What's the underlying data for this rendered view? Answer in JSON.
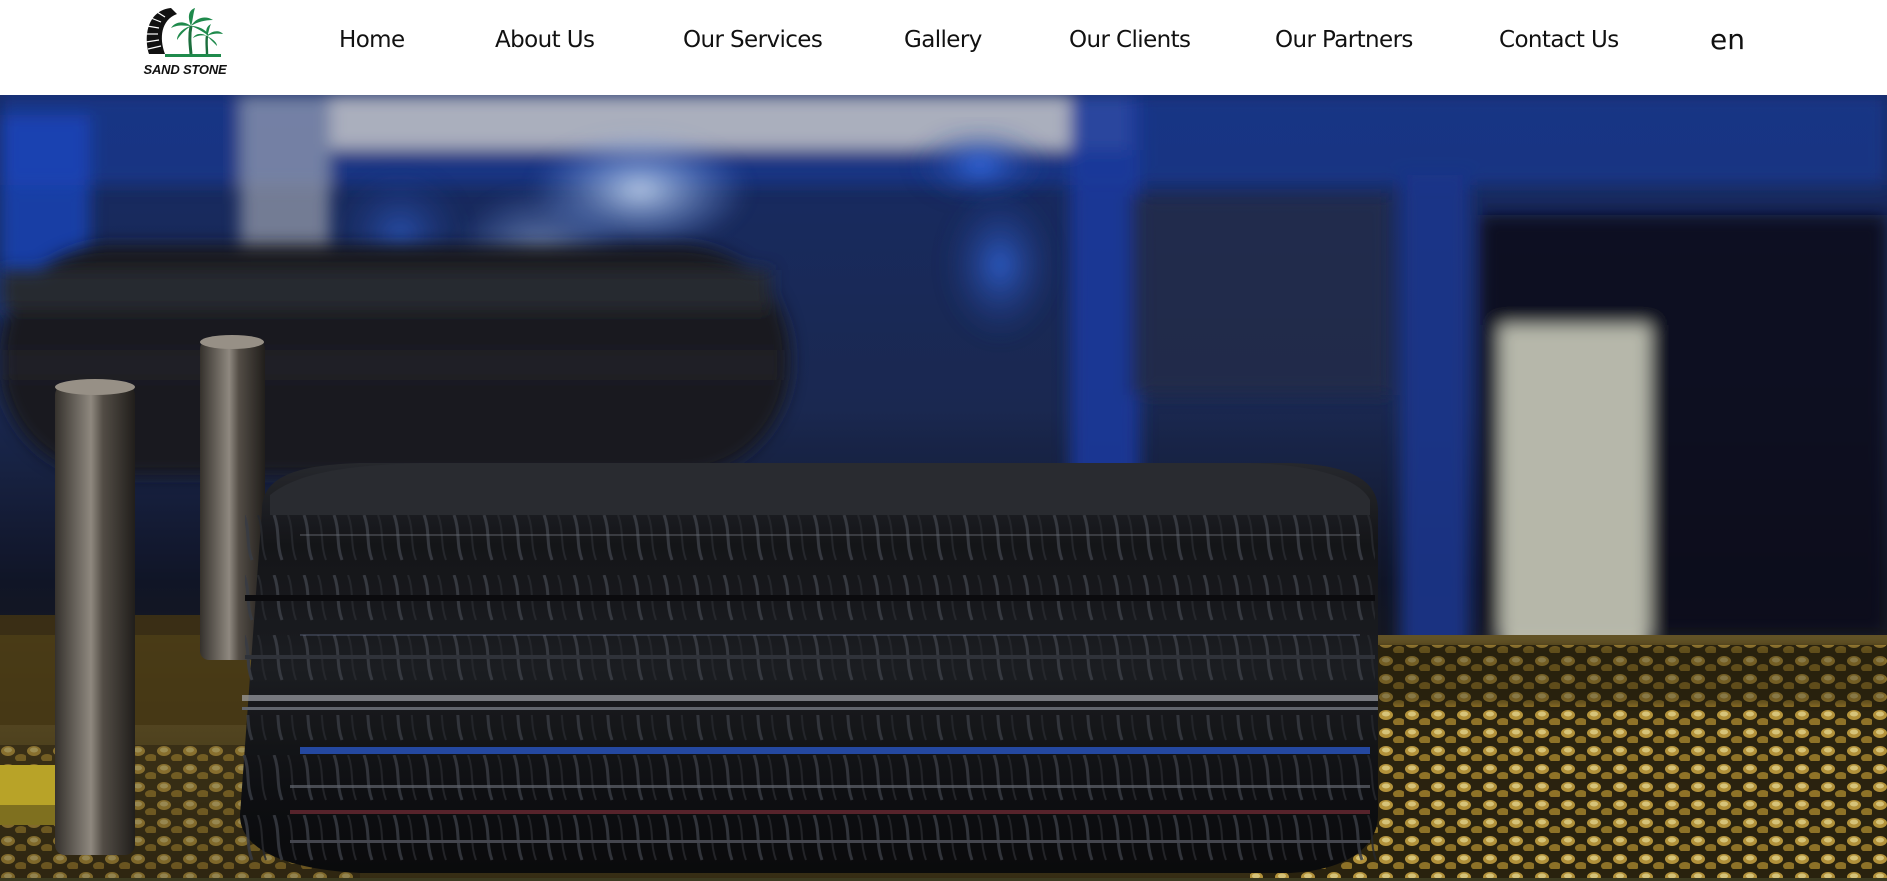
{
  "brand": {
    "logo_text": "SAND STONE",
    "colors": {
      "dark": "#111111",
      "palm_green": "#1f8a4c"
    }
  },
  "nav": {
    "items": [
      {
        "label": "Home"
      },
      {
        "label": "About Us"
      },
      {
        "label": "Our Services"
      },
      {
        "label": "Gallery"
      },
      {
        "label": "Our Clients"
      },
      {
        "label": "Our Partners"
      },
      {
        "label": "Contact Us"
      }
    ],
    "language": "en"
  },
  "hero": {
    "image": "tire-on-production-line",
    "colors": {
      "tire": "#141518",
      "factory_blue": "#1e3a8a",
      "floor_gold": "#b8952e"
    }
  }
}
